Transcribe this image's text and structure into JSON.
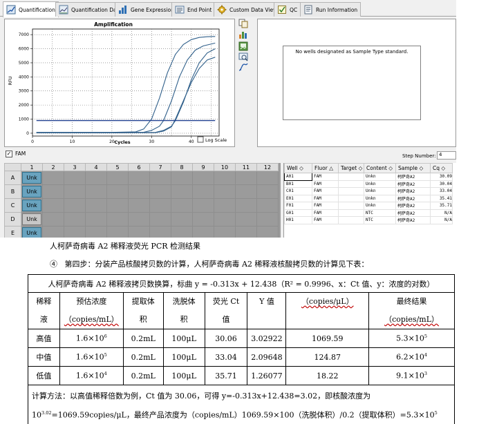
{
  "tabs": [
    {
      "label": "Quantification",
      "icon": "quantification-icon",
      "active": true
    },
    {
      "label": "Quantification Data",
      "icon": "chart-icon",
      "active": false
    },
    {
      "label": "Gene Expression",
      "icon": "bar-chart-icon",
      "active": false
    },
    {
      "label": "End Point",
      "icon": "end-point-icon",
      "active": false
    },
    {
      "label": "Custom Data View",
      "icon": "gear-icon",
      "active": false
    },
    {
      "label": "QC",
      "icon": "qc-icon",
      "active": false
    },
    {
      "label": "Run Information",
      "icon": "document-icon",
      "active": false
    }
  ],
  "chart_data": {
    "type": "line",
    "title": "Amplification",
    "xlabel": "Cycles",
    "ylabel": "RFU",
    "xlim": [
      0,
      47
    ],
    "ylim": [
      -200,
      7400
    ],
    "xticks": [
      0,
      10,
      20,
      30,
      40
    ],
    "yticks": [
      0,
      1000,
      2000,
      3000,
      4000,
      5000,
      6000,
      7000
    ],
    "grid": true,
    "threshold": 900,
    "series": [
      {
        "values": [
          [
            1,
            60
          ],
          [
            10,
            60
          ],
          [
            20,
            60
          ],
          [
            26,
            100
          ],
          [
            28,
            300
          ],
          [
            30,
            1000
          ],
          [
            32,
            2500
          ],
          [
            34,
            4300
          ],
          [
            36,
            5600
          ],
          [
            38,
            6300
          ],
          [
            40,
            6650
          ],
          [
            42,
            6800
          ],
          [
            44,
            6850
          ],
          [
            46,
            6870
          ]
        ]
      },
      {
        "values": [
          [
            1,
            50
          ],
          [
            10,
            50
          ],
          [
            20,
            50
          ],
          [
            28,
            70
          ],
          [
            30,
            200
          ],
          [
            32,
            500
          ],
          [
            33,
            900
          ],
          [
            35,
            2300
          ],
          [
            37,
            4000
          ],
          [
            39,
            5200
          ],
          [
            41,
            5900
          ],
          [
            43,
            6200
          ],
          [
            46,
            6400
          ]
        ]
      },
      {
        "values": [
          [
            1,
            40
          ],
          [
            10,
            40
          ],
          [
            20,
            40
          ],
          [
            31,
            60
          ],
          [
            33,
            200
          ],
          [
            35,
            500
          ],
          [
            36,
            900
          ],
          [
            38,
            2200
          ],
          [
            40,
            3800
          ],
          [
            42,
            5000
          ],
          [
            44,
            5700
          ],
          [
            46,
            6000
          ]
        ]
      },
      {
        "values": [
          [
            1,
            30
          ],
          [
            10,
            30
          ],
          [
            20,
            30
          ],
          [
            31,
            40
          ],
          [
            33,
            150
          ],
          [
            35,
            450
          ],
          [
            36,
            1000
          ],
          [
            38,
            2300
          ],
          [
            40,
            3600
          ],
          [
            42,
            4600
          ],
          [
            44,
            5200
          ],
          [
            46,
            5400
          ]
        ]
      }
    ]
  },
  "log_scale_label": "Log Scale",
  "std_message": "No wells designated as Sample Type standard.",
  "fam_label": "FAM",
  "step_number_label": "Step Number:",
  "step_number_value": "4",
  "plate": {
    "columns": [
      "1",
      "2",
      "3",
      "4",
      "5",
      "6",
      "7",
      "8",
      "9",
      "10",
      "11",
      "12"
    ],
    "rows": [
      {
        "label": "A",
        "well": "Unk",
        "ntc": false
      },
      {
        "label": "B",
        "well": "Unk",
        "ntc": false
      },
      {
        "label": "C",
        "well": "Unk",
        "ntc": false
      },
      {
        "label": "D",
        "well": "Unk",
        "ntc": true
      },
      {
        "label": "E",
        "well": "Unk",
        "ntc": false
      }
    ]
  },
  "wells": {
    "headers": [
      "Well",
      "Fluor",
      "Target",
      "Content",
      "Sample",
      "Cq"
    ],
    "rows": [
      [
        "A01",
        "FAM",
        "",
        "Unkn",
        "柯萨奇A2",
        "30.09"
      ],
      [
        "B01",
        "FAM",
        "",
        "Unkn",
        "柯萨奇A2",
        "30.04"
      ],
      [
        "C01",
        "FAM",
        "",
        "Unkn",
        "柯萨奇A2",
        "33.04"
      ],
      [
        "E01",
        "FAM",
        "",
        "Unkn",
        "柯萨奇A2",
        "35.41"
      ],
      [
        "F01",
        "FAM",
        "",
        "Unkn",
        "柯萨奇A2",
        "35.71"
      ],
      [
        "G01",
        "FAM",
        "",
        "NTC",
        "柯萨奇A2",
        "N/A"
      ],
      [
        "H01",
        "FAM",
        "",
        "NTC",
        "柯萨奇A2",
        "N/A"
      ]
    ]
  },
  "doc": {
    "caption": "人柯萨奇病毒 A2 稀释液荧光 PCR 检测结果",
    "step_num": "④",
    "step_text": "第四步：分装产品核酸拷贝数的计算，人柯萨奇病毒 A2 稀释液核酸拷贝数的计算见下表：",
    "table_caption": "人柯萨奇病毒 A2 稀释液拷贝数换算，标曲 y = -0.313x + 12.438（R² = 0.9996、x：Ct 值、y：浓度的对数）",
    "headers": {
      "h1a": "稀释",
      "h1b": "液",
      "h2a": "预估浓度",
      "h2b": "（copies/mL）",
      "h3a": "提取体",
      "h3b": "积",
      "h4a": "洗脱体",
      "h4b": "积",
      "h5a": "荧光 Ct",
      "h5b": "值",
      "h6": "Y 值",
      "h7": "（copies/μL）",
      "h8a": "最终结果",
      "h8b": "（copies/mL）"
    },
    "rows": [
      {
        "name": "高值",
        "est_base": "1.6×10",
        "est_exp": "6",
        "ext": "0.2mL",
        "elu": "100μL",
        "ct": "30.06",
        "y": "3.02922",
        "cpul": "1069.59",
        "fin_base": "5.3×10",
        "fin_exp": "5"
      },
      {
        "name": "中值",
        "est_base": "1.6×10",
        "est_exp": "5",
        "ext": "0.2mL",
        "elu": "100μL",
        "ct": "33.04",
        "y": "2.09648",
        "cpul": "124.87",
        "fin_base": "6.2×10",
        "fin_exp": "4"
      },
      {
        "name": "低值",
        "est_base": "1.6×10",
        "est_exp": "4",
        "ext": "0.2mL",
        "elu": "100μL",
        "ct": "35.71",
        "y": "1.26077",
        "cpul": "18.22",
        "fin_base": "9.1×10",
        "fin_exp": "3"
      }
    ],
    "note_line1": "计算方法：以高值稀释倍数为例，Ct 值为 30.06，可得 y=-0.313x+12.438=3.02，即核酸浓度为",
    "note_l2_a": "10",
    "note_l2_sup1": "3.02",
    "note_l2_b": "=1069.59copies/μL，最终产品浓度为（copies/mL）1069.59×100（洗脱体积）/0.2（提取体积）=5.3×10",
    "note_l2_sup2": "5"
  },
  "colors": {
    "curve": "#2f5f8a",
    "threshold": "#1f3f8f",
    "unk_well": "#69a3bf"
  }
}
